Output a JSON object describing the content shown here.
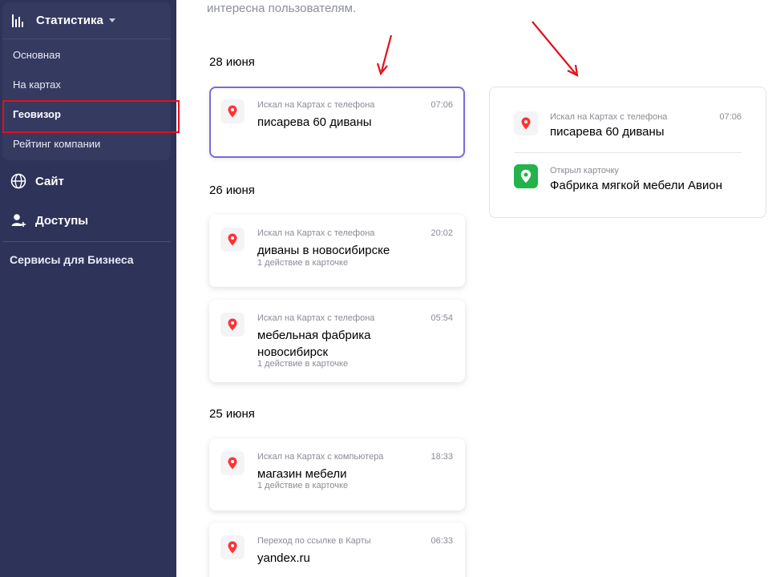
{
  "sidebar": {
    "section_title": "Статистика",
    "sub_items": [
      {
        "label": "Основная"
      },
      {
        "label": "На картах"
      },
      {
        "label": "Геовизор"
      },
      {
        "label": "Рейтинг компании"
      }
    ],
    "nav": {
      "site": "Сайт",
      "access": "Доступы"
    },
    "business_services": "Сервисы для Бизнеса"
  },
  "intro_text": "интересна пользователям.",
  "groups": [
    {
      "date": "28 июня",
      "cards": [
        {
          "source": "Искал на Картах с телефона",
          "time": "07:06",
          "query": "писарева 60 диваны"
        }
      ]
    },
    {
      "date": "26 июня",
      "cards": [
        {
          "source": "Искал на Картах с телефона",
          "time": "20:02",
          "query": "диваны в новосибирске",
          "actions": "1 действие в карточке"
        },
        {
          "source": "Искал на Картах с телефона",
          "time": "05:54",
          "query": "мебельная фабрика новосибирск",
          "actions": "1 действие в карточке"
        }
      ]
    },
    {
      "date": "25 июня",
      "cards": [
        {
          "source": "Искал на Картах с компьютера",
          "time": "18:33",
          "query": "магазин мебели",
          "actions": "1 действие в карточке"
        },
        {
          "source": "Переход по ссылке в Карты",
          "time": "06:33",
          "query": "yandex.ru"
        }
      ]
    }
  ],
  "detail": {
    "search": {
      "source": "Искал на Картах с телефона",
      "time": "07:06",
      "query": "писарева 60 диваны"
    },
    "action": {
      "source": "Открыл карточку",
      "title": "Фабрика мягкой мебели Авион"
    }
  },
  "icons": {
    "stats": "bar-chart-icon",
    "caret": "caret-down-icon",
    "site": "globe-icon",
    "access": "user-add-icon",
    "search": "map-pin-icon",
    "open_card": "green-place-icon"
  },
  "colors": {
    "sidebar_bg": "#2e3359",
    "selected_border": "#7b6bd6",
    "annotation_red": "#e3101c",
    "pin_red": "#f33",
    "green": "#22b34a"
  }
}
